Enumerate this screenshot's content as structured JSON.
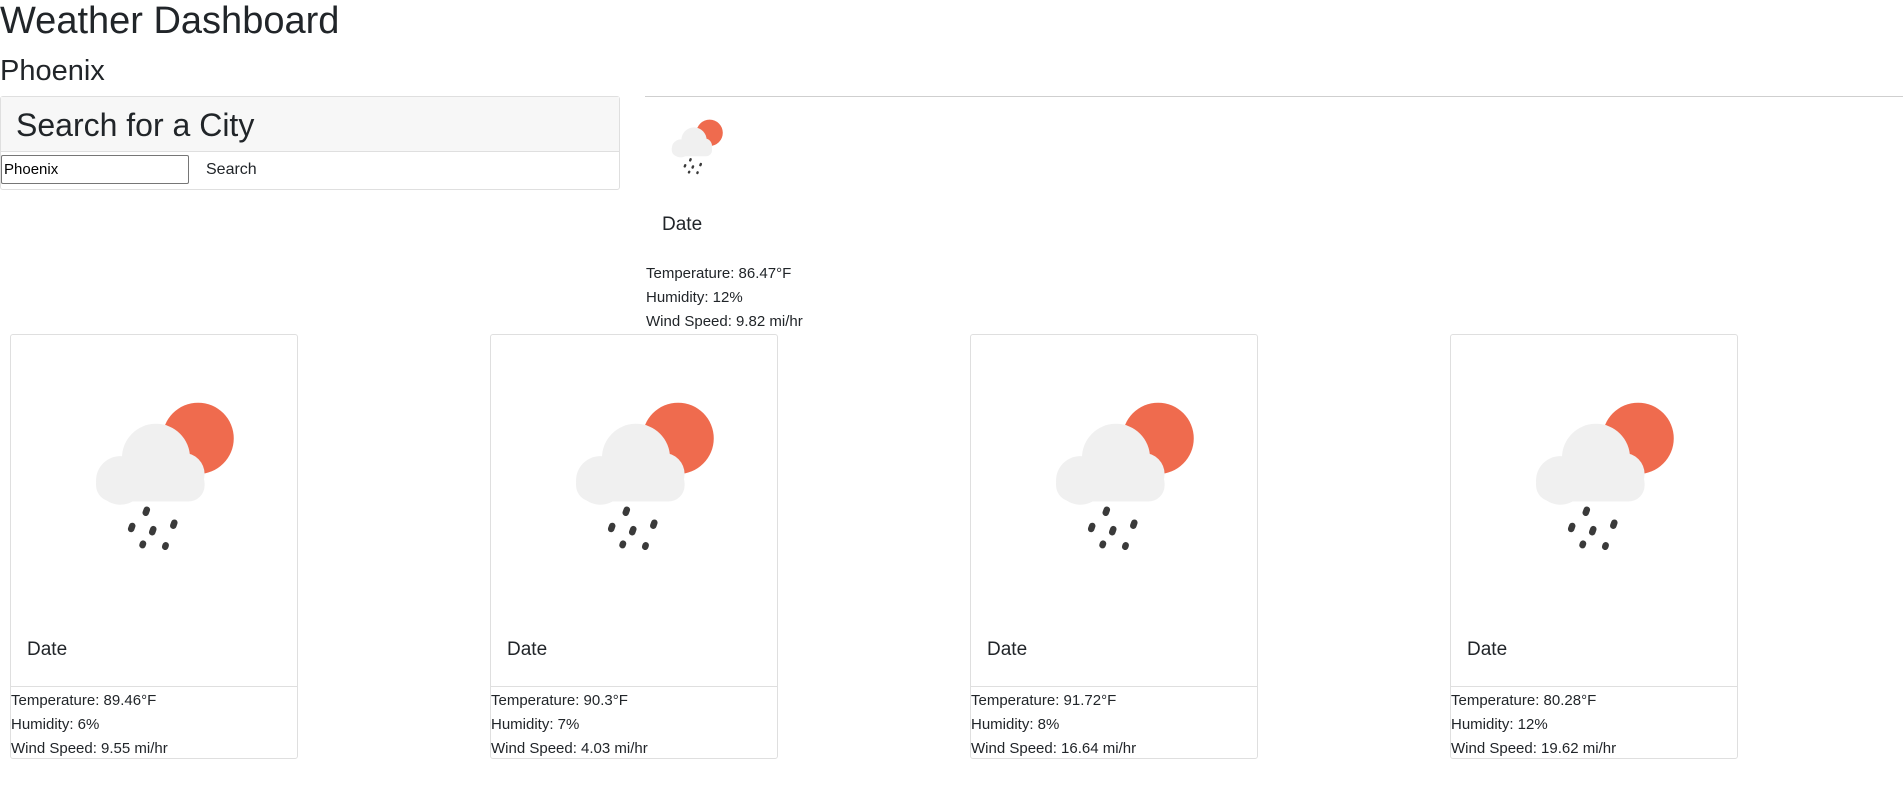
{
  "header": {
    "title": "Weather Dashboard",
    "city": "Phoenix"
  },
  "search": {
    "title": "Search for a City",
    "input_value": "Phoenix",
    "button_label": "Search"
  },
  "current": {
    "icon": "cloud-rain-sun-icon",
    "date": "Date",
    "temperature": "Temperature: 86.47°F",
    "humidity": "Humidity: 12%",
    "wind": "Wind Speed: 9.82 mi/hr"
  },
  "forecast": [
    {
      "icon": "cloud-rain-sun-icon",
      "date": "Date",
      "temperature": "Temperature: 89.46°F",
      "humidity": "Humidity: 6%",
      "wind": "Wind Speed: 9.55 mi/hr"
    },
    {
      "icon": "cloud-rain-sun-icon",
      "date": "Date",
      "temperature": "Temperature: 90.3°F",
      "humidity": "Humidity: 7%",
      "wind": "Wind Speed: 4.03 mi/hr"
    },
    {
      "icon": "cloud-rain-sun-icon",
      "date": "Date",
      "temperature": "Temperature: 91.72°F",
      "humidity": "Humidity: 8%",
      "wind": "Wind Speed: 16.64 mi/hr"
    },
    {
      "icon": "cloud-rain-sun-icon",
      "date": "Date",
      "temperature": "Temperature: 80.28°F",
      "humidity": "Humidity: 12%",
      "wind": "Wind Speed: 19.62 mi/hr"
    }
  ],
  "colors": {
    "sun": "#ef6b4e",
    "cloud": "#f0f0f0",
    "rain": "#3a3a3a",
    "border": "#dfdfdf",
    "header_bg": "#f7f7f7"
  }
}
